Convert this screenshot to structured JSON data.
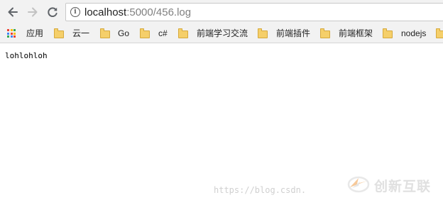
{
  "browser": {
    "url_host": "localhost",
    "url_path": ":5000/456.log",
    "info_icon": "info-icon"
  },
  "bookmarks": [
    {
      "icon": "apps-grid-icon",
      "label": "应用"
    },
    {
      "icon": "folder-icon",
      "label": "云一"
    },
    {
      "icon": "folder-icon",
      "label": "Go"
    },
    {
      "icon": "folder-icon",
      "label": "c#"
    },
    {
      "icon": "folder-icon",
      "label": "前端学习交流"
    },
    {
      "icon": "folder-icon",
      "label": "前端插件"
    },
    {
      "icon": "folder-icon",
      "label": "前端框架"
    },
    {
      "icon": "folder-icon",
      "label": "nodejs"
    },
    {
      "icon": "folder-icon",
      "label": ""
    }
  ],
  "page": {
    "content": "lohlohloh"
  },
  "watermark": {
    "url": "https://blog.csdn.",
    "brand": "创新互联"
  },
  "colors": {
    "toolbar_bg": "#f2f2f2",
    "folder": "#f5cf6a",
    "apps_grid": [
      "#ea4335",
      "#fbbc05",
      "#34a853",
      "#4285f4"
    ]
  }
}
